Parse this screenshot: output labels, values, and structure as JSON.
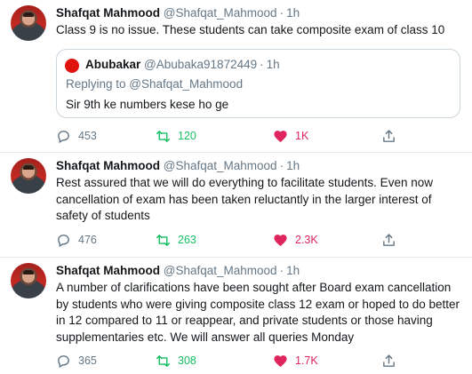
{
  "tweets": [
    {
      "name": "Shafqat Mahmood",
      "handle": "@Shafqat_Mahmood",
      "separator": "·",
      "time": "1h",
      "text": "Class 9 is no issue. These students can take composite exam of class 10",
      "quote": {
        "name": "Abubakar",
        "handle": "@Abubaka91872449",
        "separator": "·",
        "time": "1h",
        "replying_to": "Replying to @Shafqat_Mahmood",
        "text": "Sir 9th ke numbers kese ho ge"
      },
      "replies": "453",
      "retweets": "120",
      "likes": "1K"
    },
    {
      "name": "Shafqat Mahmood",
      "handle": "@Shafqat_Mahmood",
      "separator": "·",
      "time": "1h",
      "text": "Rest assured that we will do everything to facilitate students. Even now cancellation of exam has been taken reluctantly in the larger interest of safety of students",
      "replies": "476",
      "retweets": "263",
      "likes": "2.3K"
    },
    {
      "name": "Shafqat Mahmood",
      "handle": "@Shafqat_Mahmood",
      "separator": "·",
      "time": "1h",
      "text": "A number of clarifications have been sought after Board exam cancellation by students who were giving composite class 12 exam or hoped to do better in 12 compared to 11 or reappear, and private students or those having supplementaries etc. We will answer all queries Monday",
      "replies": "365",
      "retweets": "308",
      "likes": "1.7K"
    }
  ],
  "colors": {
    "text": "#14171a",
    "muted": "#657786",
    "retweet": "#17bf63",
    "like": "#e0245e",
    "border": "#e6ecf0"
  },
  "icons": [
    "reply-icon",
    "retweet-icon",
    "heart-icon",
    "share-icon"
  ]
}
